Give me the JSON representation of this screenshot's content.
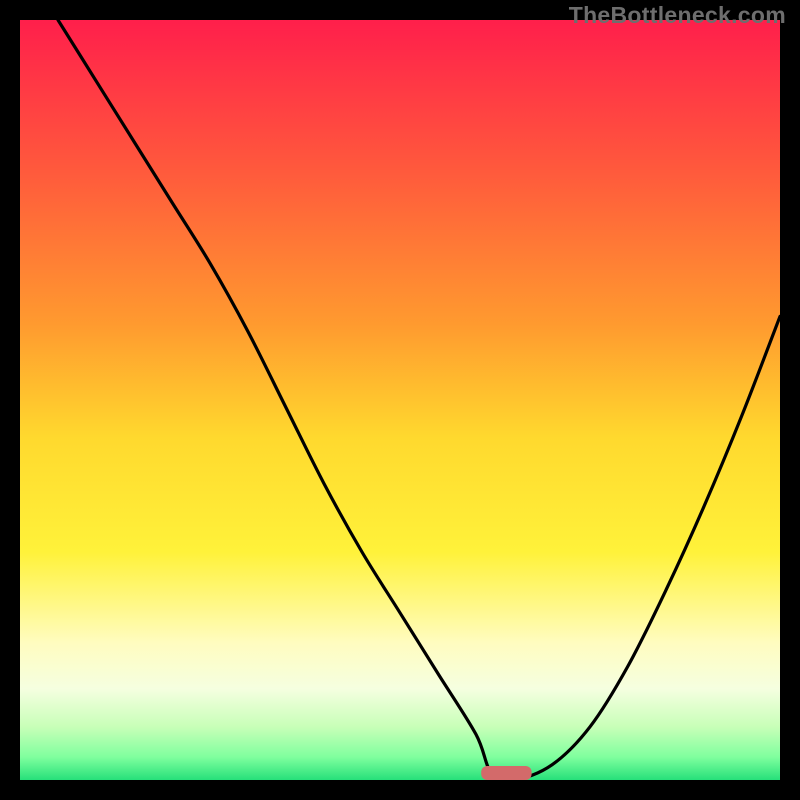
{
  "watermark": "TheBottleneck.com",
  "chart_data": {
    "type": "line",
    "title": "",
    "xlabel": "",
    "ylabel": "",
    "xlim": [
      0,
      100
    ],
    "ylim": [
      0,
      100
    ],
    "grid": false,
    "legend": null,
    "x": [
      5,
      10,
      15,
      20,
      25,
      30,
      35,
      40,
      45,
      50,
      55,
      60,
      62,
      65,
      70,
      75,
      80,
      85,
      90,
      95,
      100
    ],
    "values": [
      100,
      92,
      84,
      76,
      68,
      59,
      49,
      39,
      30,
      22,
      14,
      6,
      1,
      0,
      2,
      7,
      15,
      25,
      36,
      48,
      61
    ],
    "optimum_x": 64,
    "optimum_width": 4,
    "gradient_stops": [
      {
        "offset": 0.0,
        "color": "#ff1f4b"
      },
      {
        "offset": 0.2,
        "color": "#ff5a3c"
      },
      {
        "offset": 0.4,
        "color": "#ff9a2f"
      },
      {
        "offset": 0.55,
        "color": "#ffd92e"
      },
      {
        "offset": 0.7,
        "color": "#fff23a"
      },
      {
        "offset": 0.82,
        "color": "#fffcc0"
      },
      {
        "offset": 0.88,
        "color": "#f5ffe0"
      },
      {
        "offset": 0.93,
        "color": "#c8ffb8"
      },
      {
        "offset": 0.97,
        "color": "#7fff9e"
      },
      {
        "offset": 1.0,
        "color": "#26e07a"
      }
    ]
  }
}
